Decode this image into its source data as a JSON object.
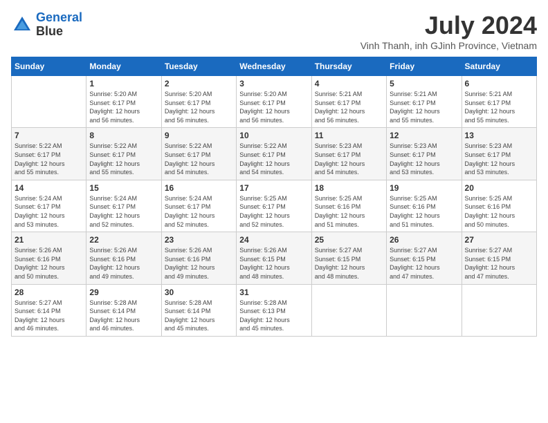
{
  "header": {
    "logo_line1": "General",
    "logo_line2": "Blue",
    "month": "July 2024",
    "location": "Vinh Thanh, inh GJinh Province, Vietnam"
  },
  "weekdays": [
    "Sunday",
    "Monday",
    "Tuesday",
    "Wednesday",
    "Thursday",
    "Friday",
    "Saturday"
  ],
  "weeks": [
    [
      {
        "day": "",
        "info": ""
      },
      {
        "day": "1",
        "info": "Sunrise: 5:20 AM\nSunset: 6:17 PM\nDaylight: 12 hours\nand 56 minutes."
      },
      {
        "day": "2",
        "info": "Sunrise: 5:20 AM\nSunset: 6:17 PM\nDaylight: 12 hours\nand 56 minutes."
      },
      {
        "day": "3",
        "info": "Sunrise: 5:20 AM\nSunset: 6:17 PM\nDaylight: 12 hours\nand 56 minutes."
      },
      {
        "day": "4",
        "info": "Sunrise: 5:21 AM\nSunset: 6:17 PM\nDaylight: 12 hours\nand 56 minutes."
      },
      {
        "day": "5",
        "info": "Sunrise: 5:21 AM\nSunset: 6:17 PM\nDaylight: 12 hours\nand 55 minutes."
      },
      {
        "day": "6",
        "info": "Sunrise: 5:21 AM\nSunset: 6:17 PM\nDaylight: 12 hours\nand 55 minutes."
      }
    ],
    [
      {
        "day": "7",
        "info": "Sunrise: 5:22 AM\nSunset: 6:17 PM\nDaylight: 12 hours\nand 55 minutes."
      },
      {
        "day": "8",
        "info": "Sunrise: 5:22 AM\nSunset: 6:17 PM\nDaylight: 12 hours\nand 55 minutes."
      },
      {
        "day": "9",
        "info": "Sunrise: 5:22 AM\nSunset: 6:17 PM\nDaylight: 12 hours\nand 54 minutes."
      },
      {
        "day": "10",
        "info": "Sunrise: 5:22 AM\nSunset: 6:17 PM\nDaylight: 12 hours\nand 54 minutes."
      },
      {
        "day": "11",
        "info": "Sunrise: 5:23 AM\nSunset: 6:17 PM\nDaylight: 12 hours\nand 54 minutes."
      },
      {
        "day": "12",
        "info": "Sunrise: 5:23 AM\nSunset: 6:17 PM\nDaylight: 12 hours\nand 53 minutes."
      },
      {
        "day": "13",
        "info": "Sunrise: 5:23 AM\nSunset: 6:17 PM\nDaylight: 12 hours\nand 53 minutes."
      }
    ],
    [
      {
        "day": "14",
        "info": "Sunrise: 5:24 AM\nSunset: 6:17 PM\nDaylight: 12 hours\nand 53 minutes."
      },
      {
        "day": "15",
        "info": "Sunrise: 5:24 AM\nSunset: 6:17 PM\nDaylight: 12 hours\nand 52 minutes."
      },
      {
        "day": "16",
        "info": "Sunrise: 5:24 AM\nSunset: 6:17 PM\nDaylight: 12 hours\nand 52 minutes."
      },
      {
        "day": "17",
        "info": "Sunrise: 5:25 AM\nSunset: 6:17 PM\nDaylight: 12 hours\nand 52 minutes."
      },
      {
        "day": "18",
        "info": "Sunrise: 5:25 AM\nSunset: 6:16 PM\nDaylight: 12 hours\nand 51 minutes."
      },
      {
        "day": "19",
        "info": "Sunrise: 5:25 AM\nSunset: 6:16 PM\nDaylight: 12 hours\nand 51 minutes."
      },
      {
        "day": "20",
        "info": "Sunrise: 5:25 AM\nSunset: 6:16 PM\nDaylight: 12 hours\nand 50 minutes."
      }
    ],
    [
      {
        "day": "21",
        "info": "Sunrise: 5:26 AM\nSunset: 6:16 PM\nDaylight: 12 hours\nand 50 minutes."
      },
      {
        "day": "22",
        "info": "Sunrise: 5:26 AM\nSunset: 6:16 PM\nDaylight: 12 hours\nand 49 minutes."
      },
      {
        "day": "23",
        "info": "Sunrise: 5:26 AM\nSunset: 6:16 PM\nDaylight: 12 hours\nand 49 minutes."
      },
      {
        "day": "24",
        "info": "Sunrise: 5:26 AM\nSunset: 6:15 PM\nDaylight: 12 hours\nand 48 minutes."
      },
      {
        "day": "25",
        "info": "Sunrise: 5:27 AM\nSunset: 6:15 PM\nDaylight: 12 hours\nand 48 minutes."
      },
      {
        "day": "26",
        "info": "Sunrise: 5:27 AM\nSunset: 6:15 PM\nDaylight: 12 hours\nand 47 minutes."
      },
      {
        "day": "27",
        "info": "Sunrise: 5:27 AM\nSunset: 6:15 PM\nDaylight: 12 hours\nand 47 minutes."
      }
    ],
    [
      {
        "day": "28",
        "info": "Sunrise: 5:27 AM\nSunset: 6:14 PM\nDaylight: 12 hours\nand 46 minutes."
      },
      {
        "day": "29",
        "info": "Sunrise: 5:28 AM\nSunset: 6:14 PM\nDaylight: 12 hours\nand 46 minutes."
      },
      {
        "day": "30",
        "info": "Sunrise: 5:28 AM\nSunset: 6:14 PM\nDaylight: 12 hours\nand 45 minutes."
      },
      {
        "day": "31",
        "info": "Sunrise: 5:28 AM\nSunset: 6:13 PM\nDaylight: 12 hours\nand 45 minutes."
      },
      {
        "day": "",
        "info": ""
      },
      {
        "day": "",
        "info": ""
      },
      {
        "day": "",
        "info": ""
      }
    ]
  ]
}
